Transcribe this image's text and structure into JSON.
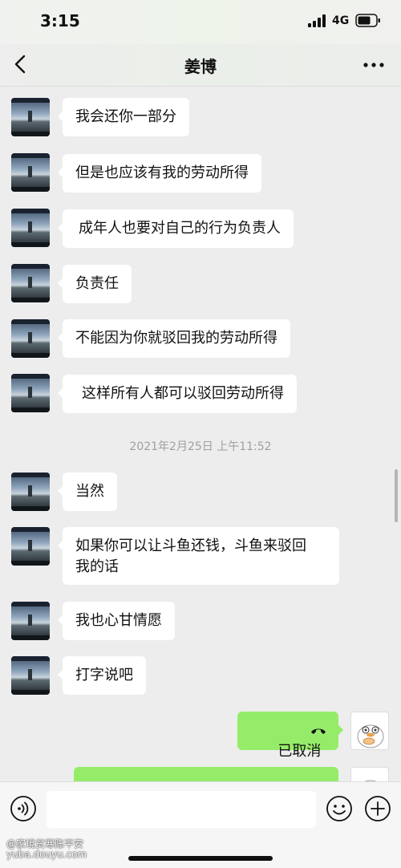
{
  "status_bar": {
    "time": "3:15",
    "network": "4G",
    "icons": [
      "signal-bars-icon",
      "battery-icon"
    ]
  },
  "header": {
    "title": "姜博",
    "icons": [
      "back-chevron-icon",
      "more-dots-icon"
    ]
  },
  "messages": [
    {
      "sender": "other",
      "text": "我会还你一部分"
    },
    {
      "sender": "other",
      "text": "但是也应该有我的劳动所得"
    },
    {
      "sender": "other",
      "text": "成年人也要对自己的行为负责人"
    },
    {
      "sender": "other",
      "text": "负责任"
    },
    {
      "sender": "other",
      "text": "不能因为你就驳回我的劳动所得"
    },
    {
      "sender": "other",
      "text": "这样所有人都可以驳回劳动所得"
    },
    {
      "type": "timestamp",
      "text": "2021年2月25日 上午11:52"
    },
    {
      "sender": "other",
      "text": "当然"
    },
    {
      "sender": "other",
      "text": "如果你可以让斗鱼还钱，斗鱼来驳回\n我的话"
    },
    {
      "sender": "other",
      "text": "我也心甘情愿"
    },
    {
      "sender": "other",
      "text": "打字说吧"
    },
    {
      "sender": "me",
      "type": "call",
      "text": "已取消",
      "icon": "call-cancelled-icon"
    }
  ],
  "input_bar": {
    "placeholder": "",
    "icons": [
      "voice-icon",
      "emoji-icon",
      "plus-icon"
    ]
  },
  "watermark": {
    "line1": "@家境贫寒陈平安",
    "line2": "yuba.douyu.com"
  },
  "colors": {
    "background": "#ededed",
    "bubble_other": "#ffffff",
    "bubble_me": "#95ec69",
    "timestamp": "#a0a0a0"
  }
}
